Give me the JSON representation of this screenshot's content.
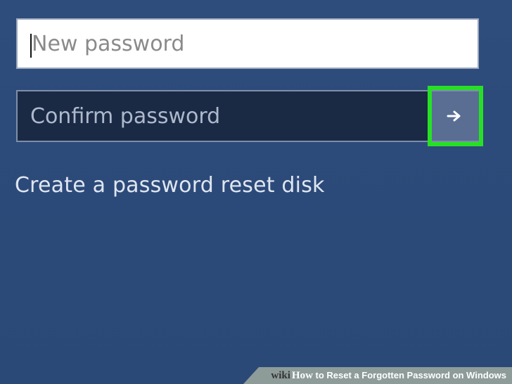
{
  "form": {
    "new_password": {
      "placeholder": "New password",
      "value": ""
    },
    "confirm_password": {
      "placeholder": "Confirm password",
      "value": ""
    },
    "submit_icon": "arrow-right-icon",
    "reset_link": "Create a password reset disk"
  },
  "watermark": {
    "logo_wiki": "wiki",
    "logo_how": "How",
    "caption": " to Reset a Forgotten Password on Windows"
  },
  "colors": {
    "background": "#2d4b7a",
    "confirm_field_bg": "#1b2a44",
    "submit_button_bg": "#5a6e94",
    "highlight": "#27e026"
  }
}
